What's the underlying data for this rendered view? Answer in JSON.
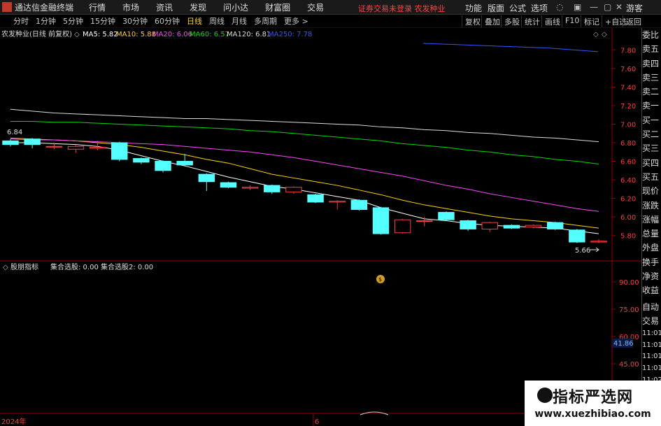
{
  "menubar": {
    "app_title": "通达信金融终端",
    "menus": [
      "行情",
      "市场",
      "资讯",
      "发现",
      "问小达",
      "财富圈",
      "交易"
    ],
    "status": "证券交易未登录   农发种业",
    "right_menus": [
      "功能",
      "版面",
      "公式",
      "选项"
    ],
    "guest": "游客",
    "icons": [
      "shield-icon",
      "grid-icon",
      "minimize-icon",
      "restore-icon",
      "close-icon"
    ]
  },
  "tabs": {
    "items": [
      "分时",
      "1分钟",
      "5分钟",
      "15分钟",
      "30分钟",
      "60分钟",
      "日线",
      "周线",
      "月线",
      "多周期",
      "更多 >"
    ],
    "active": "日线",
    "right_buttons": [
      "复权",
      "叠加",
      "多股",
      "统计",
      "画线",
      "F10",
      "标记",
      "+自选",
      "返回"
    ]
  },
  "main_chart": {
    "title": "农发种业(日线 前复权)",
    "ma_labels": [
      {
        "text": "MA5: 5.82",
        "color": "#ffffff"
      },
      {
        "text": "MA10: 5.88",
        "color": "#ffd700"
      },
      {
        "text": "MA20: 6.06",
        "color": "#ff44ff"
      },
      {
        "text": "MA60: 6.57",
        "color": "#00dd00"
      },
      {
        "text": "MA120: 6.81",
        "color": "#dddddd"
      },
      {
        "text": "MA250: 7.78",
        "color": "#3355ff"
      }
    ],
    "y_ticks": [
      "7.80",
      "7.60",
      "7.40",
      "7.20",
      "7.00",
      "6.80",
      "6.60",
      "6.40",
      "6.20",
      "6.00",
      "5.80"
    ],
    "low_label": "5.66",
    "high_label": "6.84"
  },
  "chart_data": {
    "type": "candlestick",
    "ylim": [
      5.7,
      7.9
    ],
    "candles": [
      {
        "o": 6.82,
        "c": 6.78,
        "h": 6.84,
        "l": 6.76
      },
      {
        "o": 6.84,
        "c": 6.78,
        "h": 6.85,
        "l": 6.74
      },
      {
        "o": 6.76,
        "c": 6.76,
        "h": 6.8,
        "l": 6.73
      },
      {
        "o": 6.73,
        "c": 6.76,
        "h": 6.78,
        "l": 6.69
      },
      {
        "o": 6.74,
        "c": 6.75,
        "h": 6.82,
        "l": 6.72
      },
      {
        "o": 6.8,
        "c": 6.62,
        "h": 6.81,
        "l": 6.6
      },
      {
        "o": 6.63,
        "c": 6.59,
        "h": 6.64,
        "l": 6.57
      },
      {
        "o": 6.6,
        "c": 6.5,
        "h": 6.61,
        "l": 6.48
      },
      {
        "o": 6.6,
        "c": 6.56,
        "h": 6.68,
        "l": 6.55
      },
      {
        "o": 6.46,
        "c": 6.38,
        "h": 6.47,
        "l": 6.28
      },
      {
        "o": 6.37,
        "c": 6.32,
        "h": 6.38,
        "l": 6.31
      },
      {
        "o": 6.31,
        "c": 6.32,
        "h": 6.34,
        "l": 6.29
      },
      {
        "o": 6.34,
        "c": 6.27,
        "h": 6.35,
        "l": 6.25
      },
      {
        "o": 6.27,
        "c": 6.32,
        "h": 6.33,
        "l": 6.25
      },
      {
        "o": 6.24,
        "c": 6.16,
        "h": 6.25,
        "l": 6.15
      },
      {
        "o": 6.16,
        "c": 6.17,
        "h": 6.18,
        "l": 6.08
      },
      {
        "o": 6.18,
        "c": 6.08,
        "h": 6.19,
        "l": 6.07
      },
      {
        "o": 6.1,
        "c": 5.82,
        "h": 6.11,
        "l": 5.81
      },
      {
        "o": 5.83,
        "c": 5.97,
        "h": 5.98,
        "l": 5.82
      },
      {
        "o": 5.96,
        "c": 5.96,
        "h": 6.0,
        "l": 5.9
      },
      {
        "o": 6.05,
        "c": 5.97,
        "h": 6.06,
        "l": 5.96
      },
      {
        "o": 5.96,
        "c": 5.87,
        "h": 5.97,
        "l": 5.85
      },
      {
        "o": 5.87,
        "c": 5.94,
        "h": 5.95,
        "l": 5.84
      },
      {
        "o": 5.91,
        "c": 5.88,
        "h": 5.92,
        "l": 5.87
      },
      {
        "o": 5.89,
        "c": 5.91,
        "h": 5.92,
        "l": 5.88
      },
      {
        "o": 5.94,
        "c": 5.87,
        "h": 5.95,
        "l": 5.86
      },
      {
        "o": 5.86,
        "c": 5.73,
        "h": 5.87,
        "l": 5.72
      },
      {
        "o": 5.73,
        "c": 5.74,
        "h": 5.76,
        "l": 5.72
      }
    ],
    "ma": {
      "MA5": [
        6.8,
        6.8,
        6.79,
        6.78,
        6.76,
        6.72,
        6.66,
        6.6,
        6.55,
        6.49,
        6.43,
        6.38,
        6.33,
        6.3,
        6.26,
        6.22,
        6.18,
        6.1,
        6.04,
        5.98,
        5.96,
        5.93,
        5.91,
        5.9,
        5.89,
        5.88,
        5.85,
        5.82
      ],
      "MA10": [
        6.85,
        6.84,
        6.83,
        6.82,
        6.8,
        6.78,
        6.75,
        6.71,
        6.67,
        6.62,
        6.58,
        6.52,
        6.46,
        6.42,
        6.38,
        6.34,
        6.29,
        6.24,
        6.18,
        6.13,
        6.09,
        6.05,
        6.01,
        5.98,
        5.96,
        5.94,
        5.91,
        5.88
      ],
      "MA20": [
        6.84,
        6.83,
        6.83,
        6.82,
        6.81,
        6.8,
        6.79,
        6.78,
        6.76,
        6.74,
        6.72,
        6.7,
        6.67,
        6.64,
        6.6,
        6.56,
        6.52,
        6.48,
        6.44,
        6.39,
        6.34,
        6.3,
        6.25,
        6.21,
        6.17,
        6.13,
        6.09,
        6.06
      ],
      "MA60": [
        7.03,
        7.03,
        7.02,
        7.02,
        7.01,
        7.0,
        6.99,
        6.98,
        6.97,
        6.96,
        6.95,
        6.93,
        6.92,
        6.9,
        6.88,
        6.86,
        6.84,
        6.82,
        6.79,
        6.77,
        6.75,
        6.72,
        6.7,
        6.67,
        6.65,
        6.62,
        6.6,
        6.57
      ],
      "MA120": [
        7.16,
        7.14,
        7.12,
        7.11,
        7.1,
        7.09,
        7.08,
        7.07,
        7.06,
        7.06,
        7.05,
        7.04,
        7.03,
        7.02,
        7.01,
        7.0,
        6.99,
        6.97,
        6.96,
        6.94,
        6.93,
        6.91,
        6.9,
        6.88,
        6.86,
        6.85,
        6.83,
        6.81
      ],
      "MA250": [
        null,
        null,
        null,
        null,
        null,
        null,
        null,
        null,
        null,
        null,
        null,
        null,
        null,
        null,
        null,
        null,
        null,
        null,
        null,
        null,
        7.87,
        7.86,
        7.85,
        7.84,
        7.83,
        7.82,
        7.8,
        7.78
      ]
    }
  },
  "lower_chart": {
    "title": "股朋指标",
    "values": "集合选股: 0.00  集合选股2: 0.00",
    "y_ticks": [
      "90.00",
      "75.00",
      "60.00",
      "45.00",
      "30.00"
    ],
    "current_value": "41.86"
  },
  "axis": {
    "year": "2024年",
    "month": "6"
  },
  "right_panel": {
    "items": [
      "委比",
      "卖五",
      "卖四",
      "卖三",
      "卖二",
      "卖一",
      "买一",
      "买二",
      "买三",
      "买四",
      "买五",
      "现价",
      "涨跌",
      "涨幅",
      "总量",
      "外盘",
      "换手",
      "净资",
      "收益"
    ],
    "lower_items": [
      "自动",
      "交易"
    ],
    "times": [
      "11:01",
      "11:01",
      "11:01",
      "11:01",
      "11:02",
      "11:02",
      "11:02",
      "11:02",
      "11:02",
      "11:02"
    ]
  },
  "watermark": {
    "title": "指标严选网",
    "url": "www.xuezhibiao.com"
  }
}
